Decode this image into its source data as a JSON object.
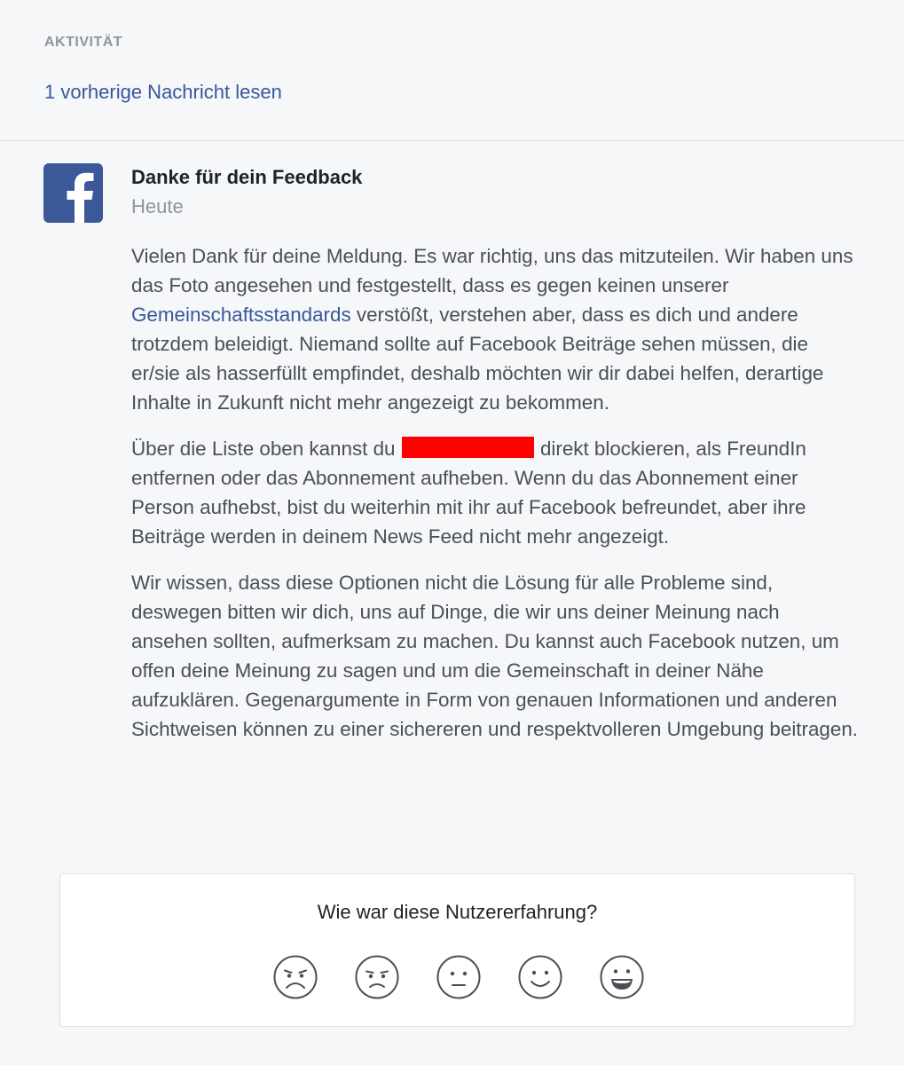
{
  "activity": {
    "label": "AKTIVITÄT",
    "previous_link": "1 vorherige Nachricht lesen"
  },
  "message": {
    "logo_icon": "facebook-f-icon",
    "brand_color": "#3b5998",
    "link_color": "#365899",
    "title": "Danke für dein Feedback",
    "date": "Heute",
    "p1_before": "Vielen Dank für deine Meldung. Es war richtig, uns das mitzuteilen. Wir haben uns das Foto angesehen und festgestellt, dass es gegen keinen unserer ",
    "p1_link": "Gemeinschaftsstandards",
    "p1_after": " verstößt, verstehen aber, dass es dich und andere trotzdem beleidigt. Niemand sollte auf Facebook Beiträge sehen müssen, die er/sie als hasserfüllt empfindet, deshalb möchten wir dir dabei helfen, derartige Inhalte in Zukunft nicht mehr angezeigt zu bekommen.",
    "p2_before": "Über die Liste oben kannst du ",
    "p2_redaction_color": "#ff0000",
    "p2_after": " direkt blockieren, als FreundIn entfernen oder das Abonnement aufheben. Wenn du das Abonnement einer Person aufhebst, bist du weiterhin mit ihr auf Facebook befreundet, aber ihre Beiträge werden in deinem News Feed nicht mehr angezeigt.",
    "p3": "Wir wissen, dass diese Optionen nicht die Lösung für alle Probleme sind, deswegen bitten wir dich, uns auf Dinge, die wir uns deiner Meinung nach ansehen sollten, aufmerksam zu machen. Du kannst auch Facebook nutzen, um offen deine Meinung zu sagen und um die Gemeinschaft in deiner Nähe aufzuklären. Gegenargumente in Form von genauen Informationen und anderen Sichtweisen können zu einer sichereren und respektvolleren Umgebung beitragen."
  },
  "survey": {
    "question": "Wie war diese Nutzererfahrung?",
    "options": [
      {
        "icon": "very-sad-face-icon"
      },
      {
        "icon": "sad-face-icon"
      },
      {
        "icon": "neutral-face-icon"
      },
      {
        "icon": "happy-face-icon"
      },
      {
        "icon": "very-happy-face-icon"
      }
    ]
  }
}
